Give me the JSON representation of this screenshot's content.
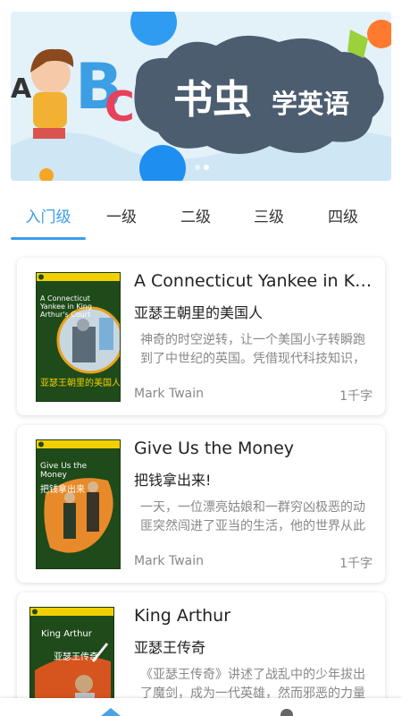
{
  "banner": {
    "title": "书虫",
    "subtitle": "学英语",
    "deco_letters": [
      "A",
      "B",
      "C"
    ]
  },
  "tabs": [
    {
      "label": "入门级",
      "active": true
    },
    {
      "label": "一级",
      "active": false
    },
    {
      "label": "二级",
      "active": false
    },
    {
      "label": "三级",
      "active": false
    },
    {
      "label": "四级",
      "active": false
    }
  ],
  "books": [
    {
      "title": "A Connecticut Yankee in King Arthur's Court",
      "title_cn": "亚瑟王朝里的美国人",
      "description": "神奇的时空逆转，让一个美国小子转瞬跑到了中世纪的英国。凭借现代科技知识，他成为了亚瑟王朝的风云人物。",
      "author": "Mark Twain",
      "words": "1千字",
      "cover_title_en": "A Connecticut Yankee in King Arthur's Court",
      "cover_title_cn": "亚瑟王朝里的美国人"
    },
    {
      "title": "Give Us the Money",
      "title_cn": "把钱拿出来!",
      "description": "一天，一位漂亮姑娘和一群穷凶极恶的动匪突然闯进了亚当的生活，他的世界从此变了。",
      "author": "Mark Twain",
      "words": "1千字",
      "cover_title_en": "Give Us the Money",
      "cover_title_cn": "把钱拿出来"
    },
    {
      "title": "King Arthur",
      "title_cn": "亚瑟王传奇",
      "description": "《亚瑟王传奇》讲述了战乱中的少年拔出了魔剑，成为一代英雄，然而邪恶的力量却在暗中滋长。",
      "author": "",
      "words": "",
      "cover_title_en": "King Arthur",
      "cover_title_cn": "亚瑟王传奇"
    }
  ],
  "colors": {
    "accent": "#3b9ee8",
    "cover_green": "#1f4a1a",
    "cover_band": "#f2d000"
  },
  "bottom_nav": {
    "icons": [
      "home-icon",
      "user-icon"
    ]
  }
}
